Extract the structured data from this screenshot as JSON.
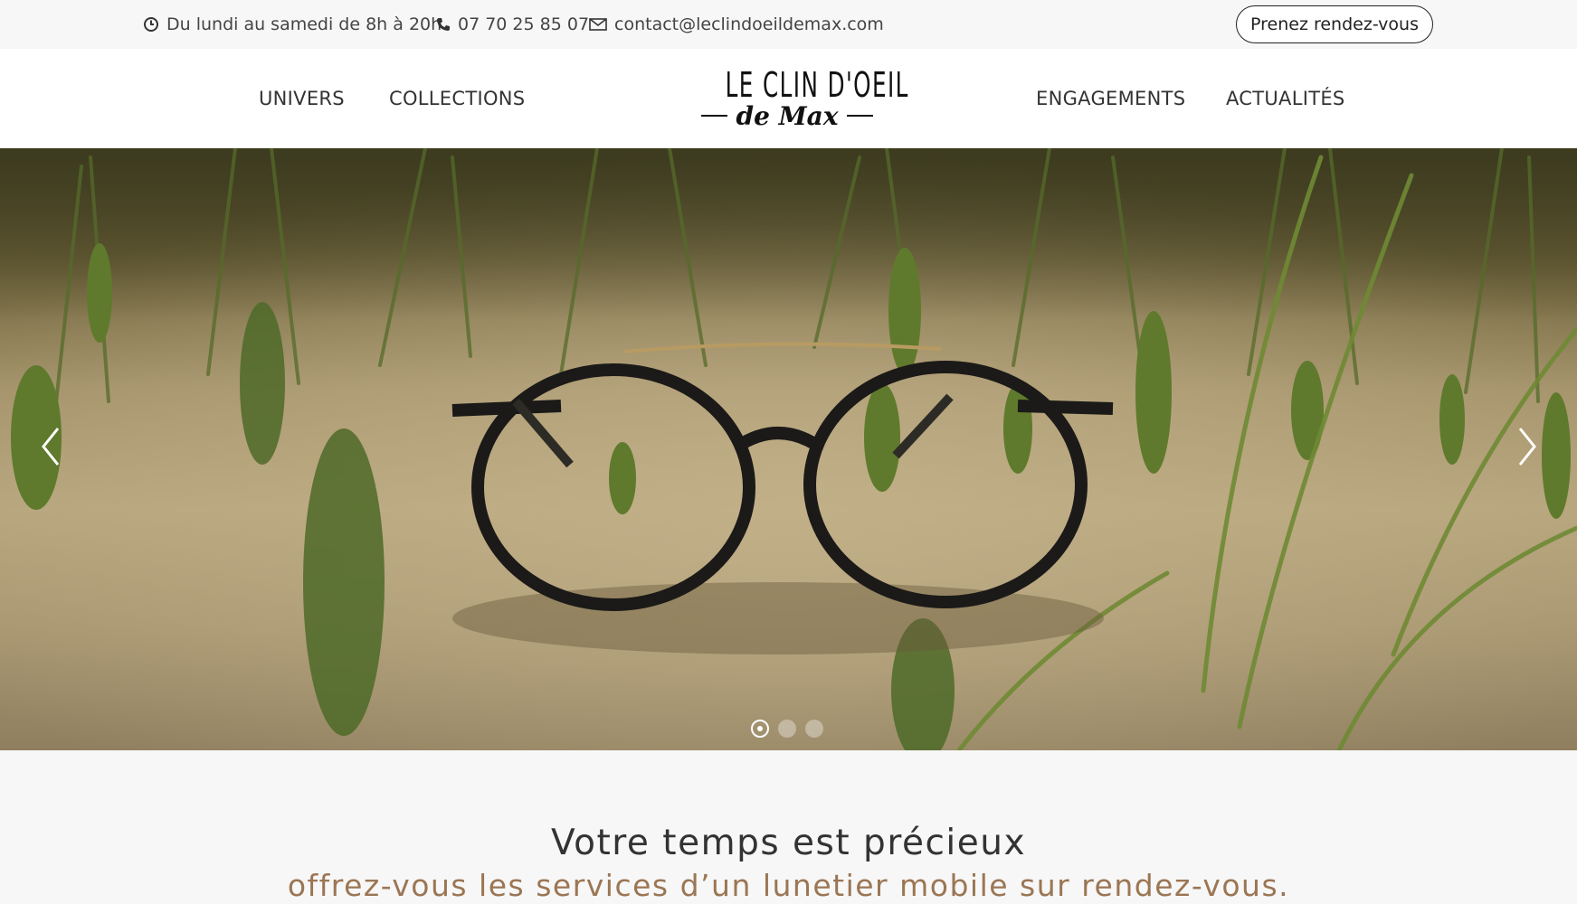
{
  "topbar": {
    "hours": "Du lundi au samedi de 8h à 20h",
    "phone": "07 70 25 85 07",
    "email": "contact@leclindoeildemax.com",
    "appointment_button": "Prenez rendez-vous",
    "icons": [
      "clock-icon",
      "phone-icon",
      "mail-icon"
    ]
  },
  "nav": {
    "left": [
      {
        "label": "UNIVERS"
      },
      {
        "label": "COLLECTIONS"
      }
    ],
    "right": [
      {
        "label": "ENGAGEMENTS"
      },
      {
        "label": "ACTUALITÉS"
      }
    ]
  },
  "logo": {
    "line1": "LE CLIN D'OEIL",
    "line2": "de Max"
  },
  "hero": {
    "slides_count": 3,
    "active_slide": 1,
    "icons": [
      "chevron-left-icon",
      "chevron-right-icon"
    ]
  },
  "tagline": {
    "title": "Votre temps est précieux",
    "subtitle": "offrez-vous les services d’un lunetier mobile sur rendez-vous."
  },
  "colors": {
    "accent": "#9b7654",
    "topbar_bg": "#f7f7f7",
    "header_bg": "#ffffff",
    "text": "#333333"
  }
}
